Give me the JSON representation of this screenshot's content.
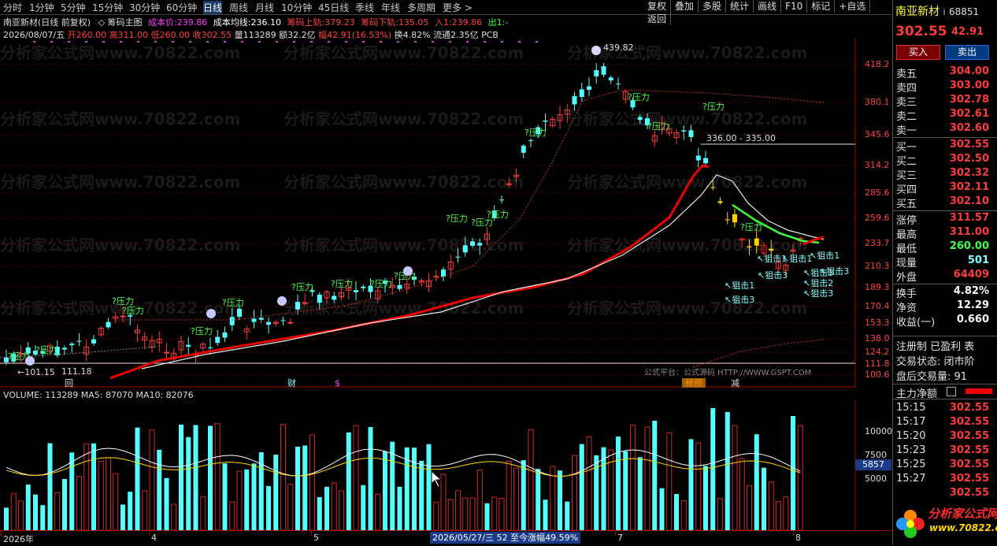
{
  "tabs": [
    "分时",
    "1分钟",
    "5分钟",
    "15分钟",
    "30分钟",
    "60分钟",
    "日线",
    "周线",
    "月线",
    "10分钟",
    "45日线",
    "季线",
    "年线",
    "多周期",
    "更多 >"
  ],
  "active_tab": "日线",
  "tools": [
    "复权",
    "叠加",
    "多股",
    "统计",
    "画线",
    "F10",
    "标记",
    "+自选",
    "返回"
  ],
  "chart_header": {
    "stock": "南亚新材(日线 前复权)",
    "indicator": "◇ 筹码主图",
    "cost_label": "成本价:",
    "cost_value": "239.86",
    "avg_cost_label": "成本均线:",
    "avg_cost_value": "236.10",
    "upper_label": "筹码上轨:",
    "upper_value": "379.23",
    "lower_label": "筹码下轨:",
    "lower_value": "135.05",
    "in_label": "入1:",
    "in_value": "239.86",
    "out_label": "出1:",
    "out_value": "-"
  },
  "day_info": {
    "date": "2026/08/07/五",
    "open": "开260.00",
    "high": "高311.00",
    "low": "低260.00",
    "close": "收302.55",
    "vol": "量113289",
    "amount": "额32.2亿",
    "change": "幅42.91(16.53%)",
    "turnover": "换4.82%",
    "float": "流通2.35亿",
    "ind": "PCB"
  },
  "watermark": "分析家公式网www.70822.com",
  "price_axis": [
    "418.2",
    "380.1",
    "345.6",
    "314.2",
    "285.6",
    "259.6",
    "233.7",
    "210.3",
    "189.3",
    "170.4",
    "153.3",
    "138.0",
    "124.2",
    "111.8",
    "100.6"
  ],
  "annotations": {
    "peak": "439.82",
    "range": "336.00 - 335.00",
    "low": "←101.15",
    "low2": "111.18",
    "pressure": "?压力",
    "snipe1": "↖狙击1",
    "snipe2": "↖狙击2",
    "snipe3": "↖狙击3",
    "platform": "公式平台：公式源码 HTTP://WWW.GSPT.COM"
  },
  "events": [
    "回",
    "财",
    "$",
    "榜预",
    "减"
  ],
  "volume_header": "VOLUME: 113289  MA5: 87070  MA10: 82076",
  "vol_axis": [
    "10000",
    "7500",
    "5000"
  ],
  "vol_cursor": "5857",
  "time_axis": [
    "2026年",
    "4",
    "5",
    "7",
    "8"
  ],
  "cursor_date": "2026/05/27/三 52 至今涨幅49.59%",
  "quote": {
    "name": "南亚新材",
    "code": "68851",
    "price": "302.55",
    "change": "42.91",
    "buy_btn": "买入",
    "sell_btn": "卖出",
    "asks": [
      {
        "label": "卖五",
        "price": "304.00"
      },
      {
        "label": "卖四",
        "price": "303.00"
      },
      {
        "label": "卖三",
        "price": "302.78"
      },
      {
        "label": "卖二",
        "price": "302.61"
      },
      {
        "label": "卖一",
        "price": "302.60"
      }
    ],
    "bids": [
      {
        "label": "买一",
        "price": "302.55"
      },
      {
        "label": "买二",
        "price": "302.50"
      },
      {
        "label": "买三",
        "price": "302.32"
      },
      {
        "label": "买四",
        "price": "302.11"
      },
      {
        "label": "买五",
        "price": "302.10"
      }
    ],
    "stats": [
      {
        "label": "涨停",
        "value": "311.57"
      },
      {
        "label": "最高",
        "value": "311.00"
      },
      {
        "label": "最低",
        "value": "260.00"
      },
      {
        "label": "现量",
        "value": "501"
      },
      {
        "label": "外盘",
        "value": "64409"
      }
    ],
    "stats2": [
      {
        "label": "换手",
        "value": "4.82%"
      },
      {
        "label": "净资",
        "value": "12.29"
      },
      {
        "label": "收益(一)",
        "value": "0.660"
      }
    ],
    "info1": "注册制 已盈利 表",
    "info2": "交易状态: 闭市阶",
    "info3": "盘后交易量: 91",
    "flow_title": "主力净额",
    "ticks": [
      {
        "time": "15:15",
        "price": "302.55"
      },
      {
        "time": "15:17",
        "price": "302.55"
      },
      {
        "time": "15:20",
        "price": "302.55"
      },
      {
        "time": "15:23",
        "price": "302.55"
      },
      {
        "time": "15:25",
        "price": "302.55"
      },
      {
        "time": "15:27",
        "price": "302.55"
      },
      {
        "time": "",
        "price": "302.55"
      }
    ],
    "logo_text": "分析家公式网",
    "logo_url": "www.70822.com"
  }
}
